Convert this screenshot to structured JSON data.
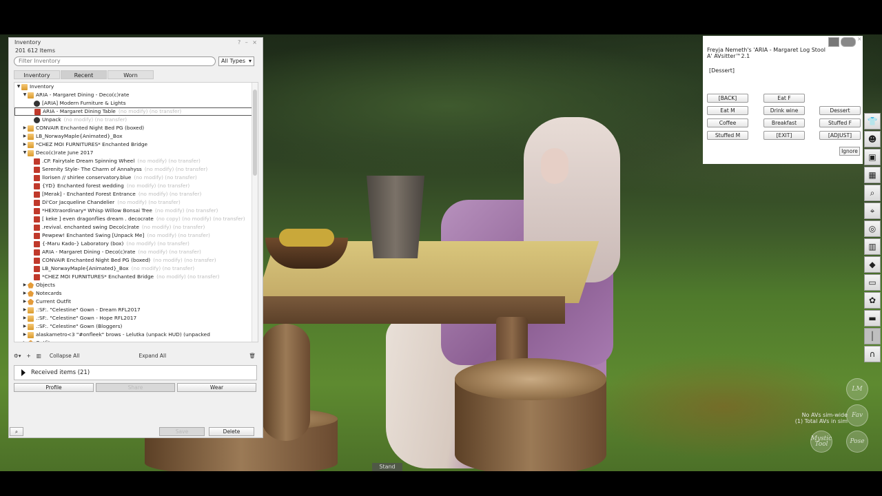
{
  "inventory": {
    "title": "Inventory",
    "title_controls": [
      "?",
      "–",
      "×"
    ],
    "item_count": "201 612 Items",
    "filter_placeholder": "Filter Inventory",
    "type_filter": "All Types",
    "tabs": [
      "Inventory",
      "Recent",
      "Worn"
    ],
    "active_tab": "Recent",
    "tree": [
      {
        "indent": 0,
        "arrow": "▼",
        "icon": "folder",
        "label": "Inventory",
        "suffix": ""
      },
      {
        "indent": 1,
        "arrow": "▼",
        "icon": "folder",
        "label": "ARIA - Margaret  Dining - Deco(c)rate",
        "suffix": ""
      },
      {
        "indent": 2,
        "arrow": "",
        "icon": "obj",
        "label": "[ARIA] Modern Furniture & Lights",
        "suffix": ""
      },
      {
        "indent": 2,
        "arrow": "",
        "icon": "box",
        "label": "ARIA - Margaret  Dining Table",
        "suffix": "(no modify) (no transfer)",
        "selected": true
      },
      {
        "indent": 2,
        "arrow": "",
        "icon": "obj",
        "label": "Unpack",
        "suffix": "(no modify) (no transfer)"
      },
      {
        "indent": 1,
        "arrow": "▶",
        "icon": "folder",
        "label": "CONVAIR Enchanted Night Bed PG (boxed)",
        "suffix": ""
      },
      {
        "indent": 1,
        "arrow": "▶",
        "icon": "folder",
        "label": "LB_NorwayMaple{Animated}_Box",
        "suffix": ""
      },
      {
        "indent": 1,
        "arrow": "▶",
        "icon": "folder",
        "label": "*CHEZ MOI FURNITURES* Enchanted Bridge",
        "suffix": ""
      },
      {
        "indent": 1,
        "arrow": "▼",
        "icon": "folder",
        "label": "Deco(c)rate June 2017",
        "suffix": ""
      },
      {
        "indent": 2,
        "arrow": "",
        "icon": "box",
        "label": ".CP. Fairytale Dream Spinning Wheel",
        "suffix": "(no modify) (no transfer)"
      },
      {
        "indent": 2,
        "arrow": "",
        "icon": "box",
        "label": "Serenity Style- The Charm of Annahyss",
        "suffix": "(no modify) (no transfer)"
      },
      {
        "indent": 2,
        "arrow": "",
        "icon": "box",
        "label": "llorisen // shirlee conservatory.blue",
        "suffix": "(no modify) (no transfer)"
      },
      {
        "indent": 2,
        "arrow": "",
        "icon": "box",
        "label": "{YD} Enchanted forest wedding",
        "suffix": "(no modify) (no transfer)"
      },
      {
        "indent": 2,
        "arrow": "",
        "icon": "box",
        "label": "[Merak] - Enchanted Forest Entrance",
        "suffix": "(no modify) (no transfer)"
      },
      {
        "indent": 2,
        "arrow": "",
        "icon": "box",
        "label": "Di'Cor Jacqueline Chandelier",
        "suffix": "(no modify) (no transfer)"
      },
      {
        "indent": 2,
        "arrow": "",
        "icon": "box",
        "label": "*HEXtraordinary* Whisp Willow Bonsai Tree",
        "suffix": "(no modify) (no transfer)"
      },
      {
        "indent": 2,
        "arrow": "",
        "icon": "box",
        "label": "[ keke ] even dragonflies dream . decocrate",
        "suffix": "(no copy) (no modify) (no transfer)"
      },
      {
        "indent": 2,
        "arrow": "",
        "icon": "box",
        "label": ".revival. enchanted swing Deco(c)rate",
        "suffix": "(no modify) (no transfer)"
      },
      {
        "indent": 2,
        "arrow": "",
        "icon": "box",
        "label": "Pewpew! Enchanted Swing [Unpack Me]",
        "suffix": "(no modify) (no transfer)"
      },
      {
        "indent": 2,
        "arrow": "",
        "icon": "box",
        "label": "{-Maru Kado-} Laboratory (box)",
        "suffix": "(no modify) (no transfer)"
      },
      {
        "indent": 2,
        "arrow": "",
        "icon": "box",
        "label": "ARIA - Margaret  Dining - Deco(c)rate",
        "suffix": "(no modify) (no transfer)"
      },
      {
        "indent": 2,
        "arrow": "",
        "icon": "box",
        "label": "CONVAIR Enchanted Night Bed PG (boxed)",
        "suffix": "(no modify) (no transfer)"
      },
      {
        "indent": 2,
        "arrow": "",
        "icon": "box",
        "label": "LB_NorwayMaple{Animated}_Box",
        "suffix": "(no modify) (no transfer)"
      },
      {
        "indent": 2,
        "arrow": "",
        "icon": "box",
        "label": "*CHEZ MOI FURNITURES* Enchanted Bridge",
        "suffix": "(no modify) (no transfer)"
      },
      {
        "indent": 1,
        "arrow": "▶",
        "icon": "special",
        "label": "Objects",
        "suffix": ""
      },
      {
        "indent": 1,
        "arrow": "▶",
        "icon": "special",
        "label": "Notecards",
        "suffix": ""
      },
      {
        "indent": 1,
        "arrow": "▶",
        "icon": "special",
        "label": "Current Outfit",
        "suffix": ""
      },
      {
        "indent": 1,
        "arrow": "▶",
        "icon": "folder",
        "label": ".:SF:. \"Celestine\" Gown - Dream RFL2017",
        "suffix": ""
      },
      {
        "indent": 1,
        "arrow": "▶",
        "icon": "folder",
        "label": ".:SF:. \"Celestine\" Gown - Hope RFL2017",
        "suffix": ""
      },
      {
        "indent": 1,
        "arrow": "▶",
        "icon": "folder",
        "label": ".:SF:. \"Celestine\" Gown (Bloggers)",
        "suffix": ""
      },
      {
        "indent": 1,
        "arrow": "▶",
        "icon": "folder",
        "label": "alaskametro<3 \"#onfleek\" brows - Lelutka (unpack HUD) (unpacked",
        "suffix": ""
      },
      {
        "indent": 1,
        "arrow": "▶",
        "icon": "special",
        "label": "Outfits",
        "suffix": ""
      }
    ],
    "tools": {
      "gear": "⚙▾",
      "add": "+",
      "collapse_all": "Collapse All",
      "expand_all": "Expand All"
    },
    "received": "Received items (21)",
    "buttons": {
      "profile": "Profile",
      "share": "Share",
      "wear": "Wear"
    },
    "footer": {
      "save": "Save",
      "delete": "Delete"
    }
  },
  "dialog": {
    "message": "Freyja Nemeth's 'ARIA - Margaret  Log Stool A' AVsitter™2.1",
    "menu": "[Dessert]",
    "buttons": [
      "[BACK]",
      "Eat F",
      "Eat M",
      "Drink wine",
      "Dessert",
      "Coffee",
      "Breakfast",
      "Stuffed F",
      "Stuffed M",
      "[EXIT]",
      "[ADJUST]"
    ],
    "ignore": "Ignore"
  },
  "scene": {
    "stand": "Stand",
    "sim_info_line1": "No AVs sim-wide",
    "sim_info_line2": "(1) Total AVs in sim",
    "hud_lm": "LM",
    "hud_fav": "Fav",
    "hud_pose": "Pose",
    "hud_mystic": "Mystic Tool"
  },
  "toolbar_icons": [
    "shirt-icon",
    "people-icon",
    "inventory-icon",
    "map-icon",
    "search-icon",
    "location-icon",
    "radar-icon",
    "world-map-icon",
    "build-icon",
    "snapshot-icon",
    "settings-icon",
    "camera-icon",
    "slider-icon",
    "headset-icon"
  ]
}
